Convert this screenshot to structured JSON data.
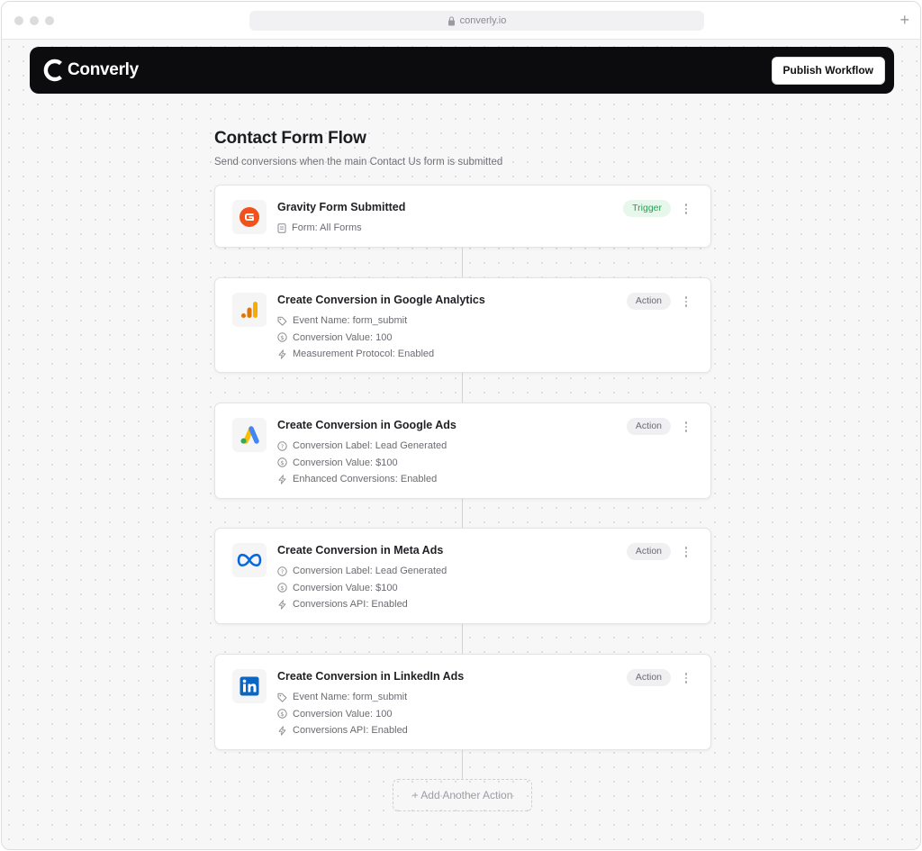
{
  "browser": {
    "url": "converly.io",
    "new_tab": "+"
  },
  "app": {
    "brand": "Converly",
    "publish_label": "Publish Workflow"
  },
  "flow": {
    "title": "Contact Form Flow",
    "subtitle": "Send conversions when the main Contact Us form is submitted"
  },
  "steps": [
    {
      "title": "Gravity Form Submitted",
      "badge": "Trigger",
      "logo": "gravity-forms-logo",
      "details": [
        {
          "icon": "document-icon",
          "text": "Form: All Forms"
        }
      ]
    },
    {
      "title": "Create Conversion in Google Analytics",
      "badge": "Action",
      "logo": "google-analytics-logo",
      "details": [
        {
          "icon": "tag-icon",
          "text": "Event Name: form_submit"
        },
        {
          "icon": "dollar-circle-icon",
          "text": "Conversion Value: 100"
        },
        {
          "icon": "bolt-icon",
          "text": "Measurement Protocol: Enabled"
        }
      ]
    },
    {
      "title": "Create Conversion in Google Ads",
      "badge": "Action",
      "logo": "google-ads-logo",
      "details": [
        {
          "icon": "help-circle-icon",
          "text": "Conversion Label: Lead Generated"
        },
        {
          "icon": "dollar-circle-icon",
          "text": "Conversion Value: $100"
        },
        {
          "icon": "bolt-icon",
          "text": "Enhanced Conversions: Enabled"
        }
      ]
    },
    {
      "title": "Create Conversion in Meta Ads",
      "badge": "Action",
      "logo": "meta-logo",
      "details": [
        {
          "icon": "help-circle-icon",
          "text": "Conversion Label: Lead Generated"
        },
        {
          "icon": "dollar-circle-icon",
          "text": "Conversion Value: $100"
        },
        {
          "icon": "bolt-icon",
          "text": "Conversions API: Enabled"
        }
      ]
    },
    {
      "title": "Create Conversion in LinkedIn Ads",
      "badge": "Action",
      "logo": "linkedin-logo",
      "details": [
        {
          "icon": "tag-icon",
          "text": "Event Name: form_submit"
        },
        {
          "icon": "dollar-circle-icon",
          "text": "Conversion Value: 100"
        },
        {
          "icon": "bolt-icon",
          "text": "Conversions API: Enabled"
        }
      ]
    }
  ],
  "add_action_label": "+ Add Another Action",
  "colors": {
    "appbar": "#0c0c0e",
    "trigger_badge_bg": "#e7f7ec",
    "trigger_badge_text": "#2f9a55",
    "gravity": "#f1511b",
    "ga_orange": "#f9ab00",
    "ga_dark": "#e37400",
    "ads_blue": "#4285f4",
    "ads_yellow": "#fbbc04",
    "ads_green": "#34a853",
    "meta_blue": "#0668e1",
    "linkedin_blue": "#0a66c2"
  }
}
